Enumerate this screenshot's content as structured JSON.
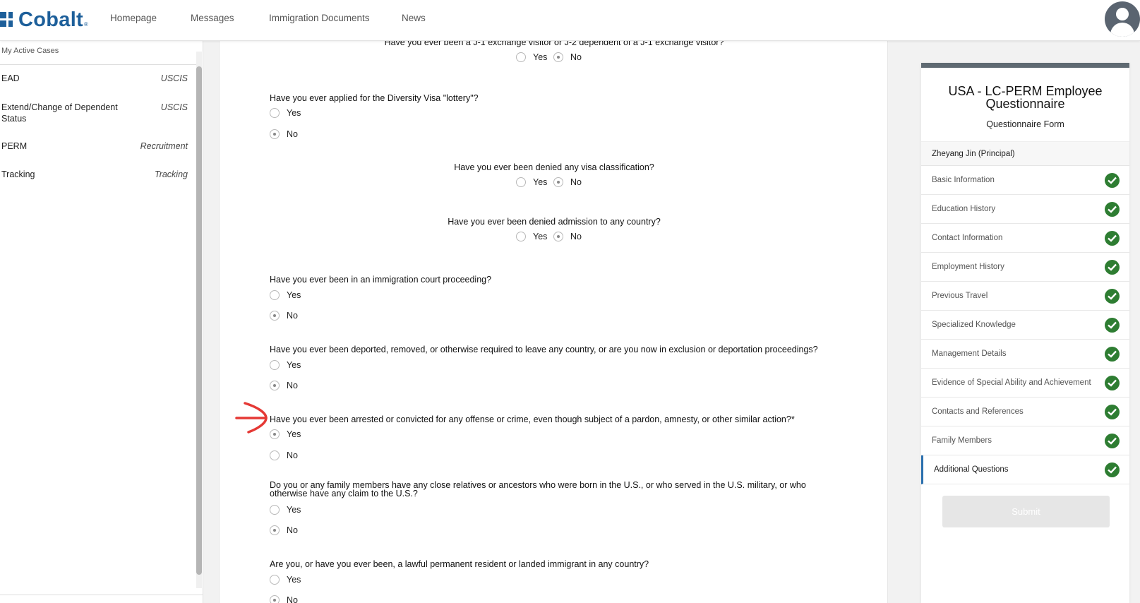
{
  "header": {
    "logo_text": "Cobalt",
    "logo_reg": "®",
    "nav": [
      "Homepage",
      "Messages",
      "Immigration Documents",
      "News"
    ]
  },
  "sidebar": {
    "heading": "My Active Cases",
    "cases": [
      {
        "name": "EAD",
        "tag": "USCIS"
      },
      {
        "name": "Extend/Change of Dependent Status",
        "tag": "USCIS"
      },
      {
        "name": "PERM",
        "tag": "Recruitment"
      },
      {
        "name": "Tracking",
        "tag": "Tracking"
      }
    ]
  },
  "form": {
    "questions": [
      {
        "text": "Have you ever been a J-1 exchange visitor or J-2 dependent of a J-1 exchange visitor?",
        "options": [
          "Yes",
          "No"
        ],
        "selected": "No"
      },
      {
        "text": "Have you ever applied for the Diversity Visa \"lottery\"?",
        "options": [
          "Yes",
          "No"
        ],
        "selected": "No"
      },
      {
        "text": "Have you ever been denied any visa classification?",
        "options": [
          "Yes",
          "No"
        ],
        "selected": "No"
      },
      {
        "text": "Have you ever been denied admission to any country?",
        "options": [
          "Yes",
          "No"
        ],
        "selected": "No"
      },
      {
        "text": "Have you ever been in an immigration court proceeding?",
        "options": [
          "Yes",
          "No"
        ],
        "selected": "No"
      },
      {
        "text": "Have you ever been deported, removed, or otherwise required to leave any country, or are you now in exclusion or deportation proceedings?",
        "options": [
          "Yes",
          "No"
        ],
        "selected": "No"
      },
      {
        "text": "Have you ever been arrested or convicted for any offense or crime, even though subject of a pardon, amnesty, or other similar action?*",
        "options": [
          "Yes",
          "No"
        ],
        "selected": "Yes"
      },
      {
        "text": "Do you or any family members have any close relatives or ancestors who were born in the U.S., or who served in the U.S. military, or who otherwise have any claim to the U.S.?",
        "options": [
          "Yes",
          "No"
        ],
        "selected": "No"
      },
      {
        "text": "Are you, or have you ever been, a lawful permanent resident or landed immigrant in any country?",
        "options": [
          "Yes",
          "No"
        ],
        "selected": "No"
      }
    ]
  },
  "panel": {
    "title_line1": "USA - LC-PERM Employee",
    "title_line2": "Questionnaire",
    "subtitle": "Questionnaire Form",
    "principal": "Zheyang Jin (Principal)",
    "sections": [
      "Basic Information",
      "Education History",
      "Contact Information",
      "Employment History",
      "Previous Travel",
      "Specialized Knowledge",
      "Management Details",
      "Evidence of Special Ability and Achievement",
      "Contacts and References",
      "Family Members",
      "Additional Questions"
    ],
    "active_section": "Additional Questions",
    "submit_label": "Submit"
  },
  "colors": {
    "brand": "#1d5f9a",
    "check": "#2e7d32",
    "annotation": "#e53935",
    "active_indicator": "#2a6fae"
  }
}
